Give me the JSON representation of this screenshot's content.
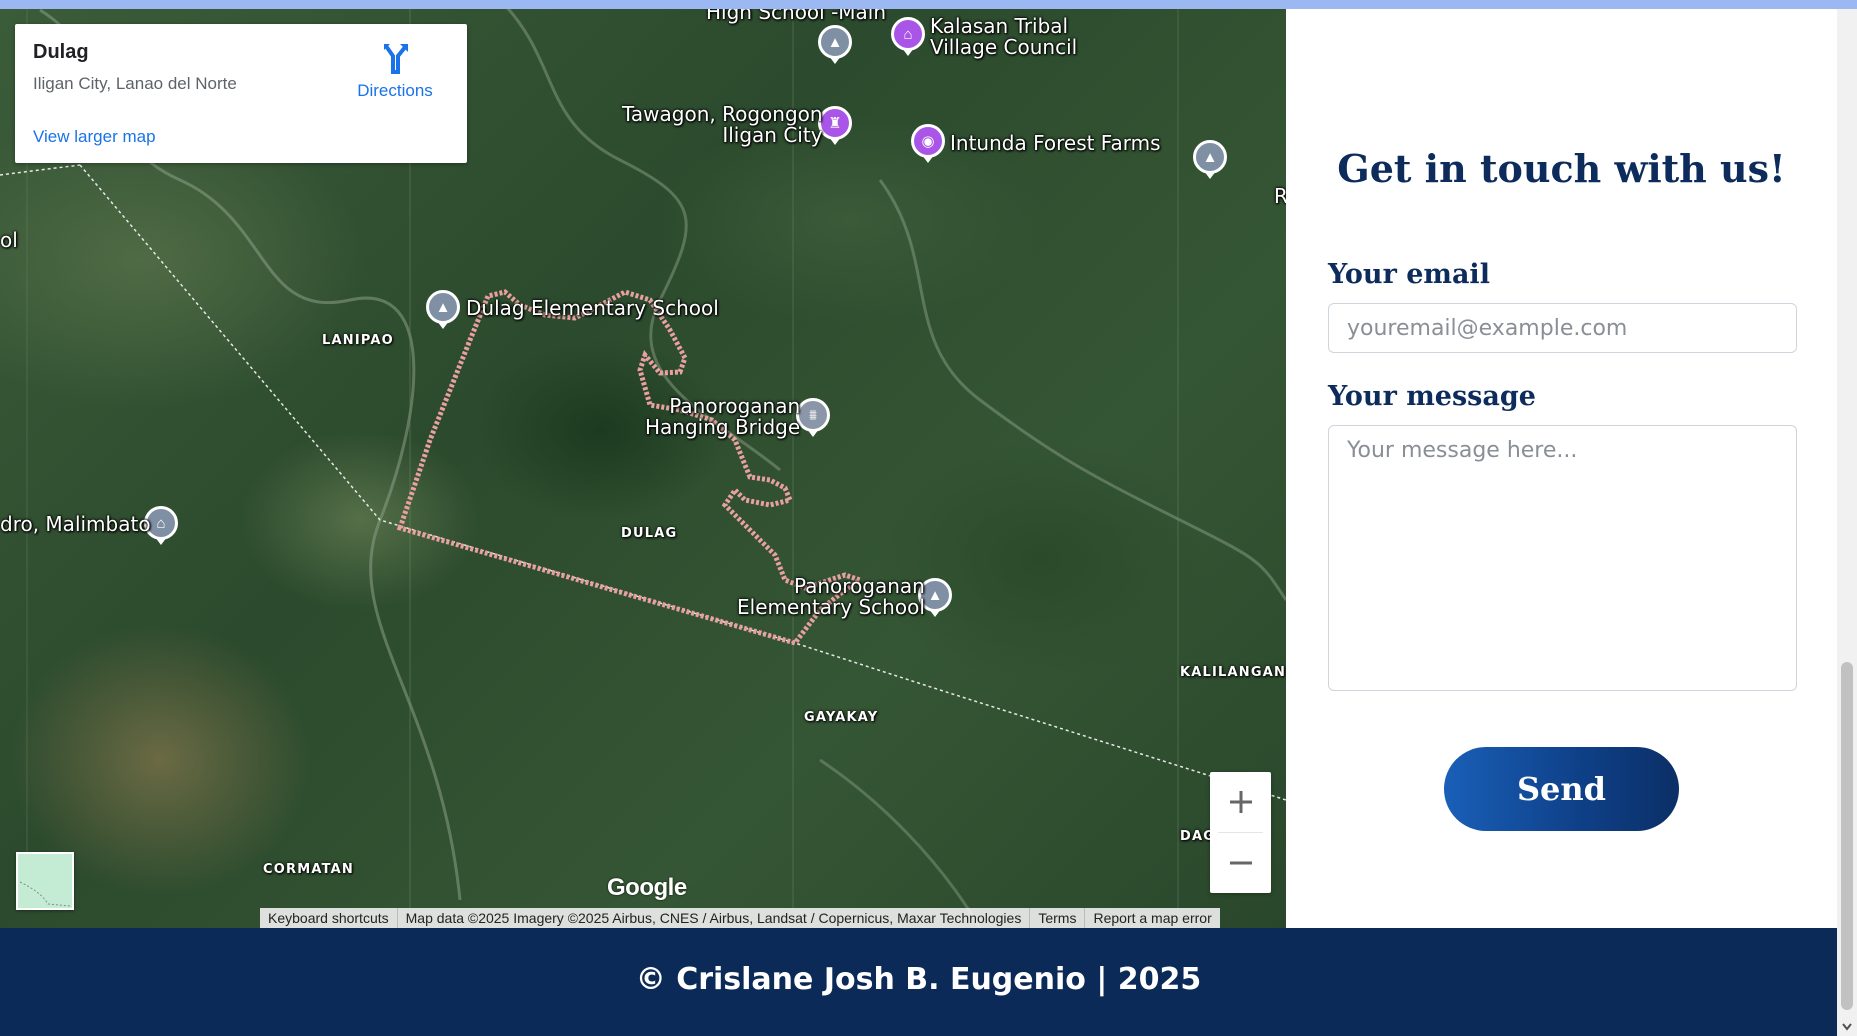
{
  "map": {
    "info_card": {
      "title": "Dulag",
      "address": "Iligan City, Lanao del Norte",
      "directions_label": "Directions",
      "view_larger_label": "View larger map"
    },
    "places": [
      {
        "name": "High School -Main",
        "icon": "school-icon"
      },
      {
        "name": "Kalasan Tribal\nVillage Council",
        "icon": "government-icon"
      },
      {
        "name": "Tawagon, Rogongon\nIligan City",
        "icon": "landmark-icon"
      },
      {
        "name": "Intunda Forest Farms",
        "icon": "camera-icon"
      },
      {
        "name": "Dulag Elementary School",
        "icon": "school-icon"
      },
      {
        "name": "Panoroganan\nHanging Bridge",
        "icon": "bridge-icon"
      },
      {
        "name": "dro, Malimbato",
        "icon": "civic-building-icon"
      },
      {
        "name": "Panoroganan\nElementary School",
        "icon": "school-icon"
      },
      {
        "name": "ol",
        "icon": ""
      },
      {
        "name": "R",
        "icon": ""
      }
    ],
    "regions": [
      "LANIPAO",
      "DULAG",
      "GAYAKAY",
      "KALILANGAN",
      "CORMATAN",
      "DAG"
    ],
    "google_logo": "Google",
    "attribution": {
      "keyboard_shortcuts": "Keyboard shortcuts",
      "map_data": "Map data ©2025 Imagery ©2025 Airbus, CNES / Airbus, Landsat / Copernicus, Maxar Technologies",
      "terms": "Terms",
      "report_error": "Report a map error"
    },
    "zoom": {
      "in_icon": "plus-icon",
      "out_icon": "minus-icon"
    },
    "boundary_color": "#e8a0a0"
  },
  "form": {
    "title": "Get in touch with us!",
    "email_label": "Your email",
    "email_placeholder": "youremail@example.com",
    "message_label": "Your message",
    "message_placeholder": "Your message here...",
    "send_label": "Send"
  },
  "footer": {
    "text": "© Crislane Josh B. Eugenio | 2025"
  },
  "colors": {
    "navy": "#0b2a57",
    "heading": "#0d2c5c",
    "accent_bar": "#9bb8f2",
    "link": "#1a73e8"
  }
}
